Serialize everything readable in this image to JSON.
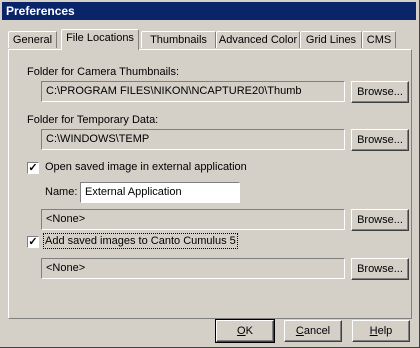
{
  "window": {
    "title": "Preferences"
  },
  "tabs": [
    {
      "label": "General"
    },
    {
      "label": "File Locations"
    },
    {
      "label": "Thumbnails"
    },
    {
      "label": "Advanced Color"
    },
    {
      "label": "Grid Lines"
    },
    {
      "label": "CMS"
    }
  ],
  "active_tab": "File Locations",
  "camera_thumbnails": {
    "label": "Folder for Camera Thumbnails:",
    "value": "C:\\PROGRAM FILES\\NIKON\\NCAPTURE20\\Thumb",
    "browse": "Browse..."
  },
  "temporary_data": {
    "label": "Folder for Temporary Data:",
    "value": "C:\\WINDOWS\\TEMP",
    "browse": "Browse..."
  },
  "external_app": {
    "checkbox_label": "Open saved image in external application",
    "checked": true,
    "name_label": "Name:",
    "name_value": "External Application",
    "path_value": "<None>",
    "browse": "Browse..."
  },
  "canto": {
    "checkbox_label": "Add saved images to Canto Cumulus 5",
    "checked": true,
    "path_value": "<None>",
    "browse": "Browse..."
  },
  "footer": {
    "ok_mnemonic": "O",
    "ok_rest": "K",
    "cancel_mnemonic": "C",
    "cancel_rest": "ancel",
    "help_mnemonic": "H",
    "help_rest": "elp"
  },
  "checkmark": "✓"
}
